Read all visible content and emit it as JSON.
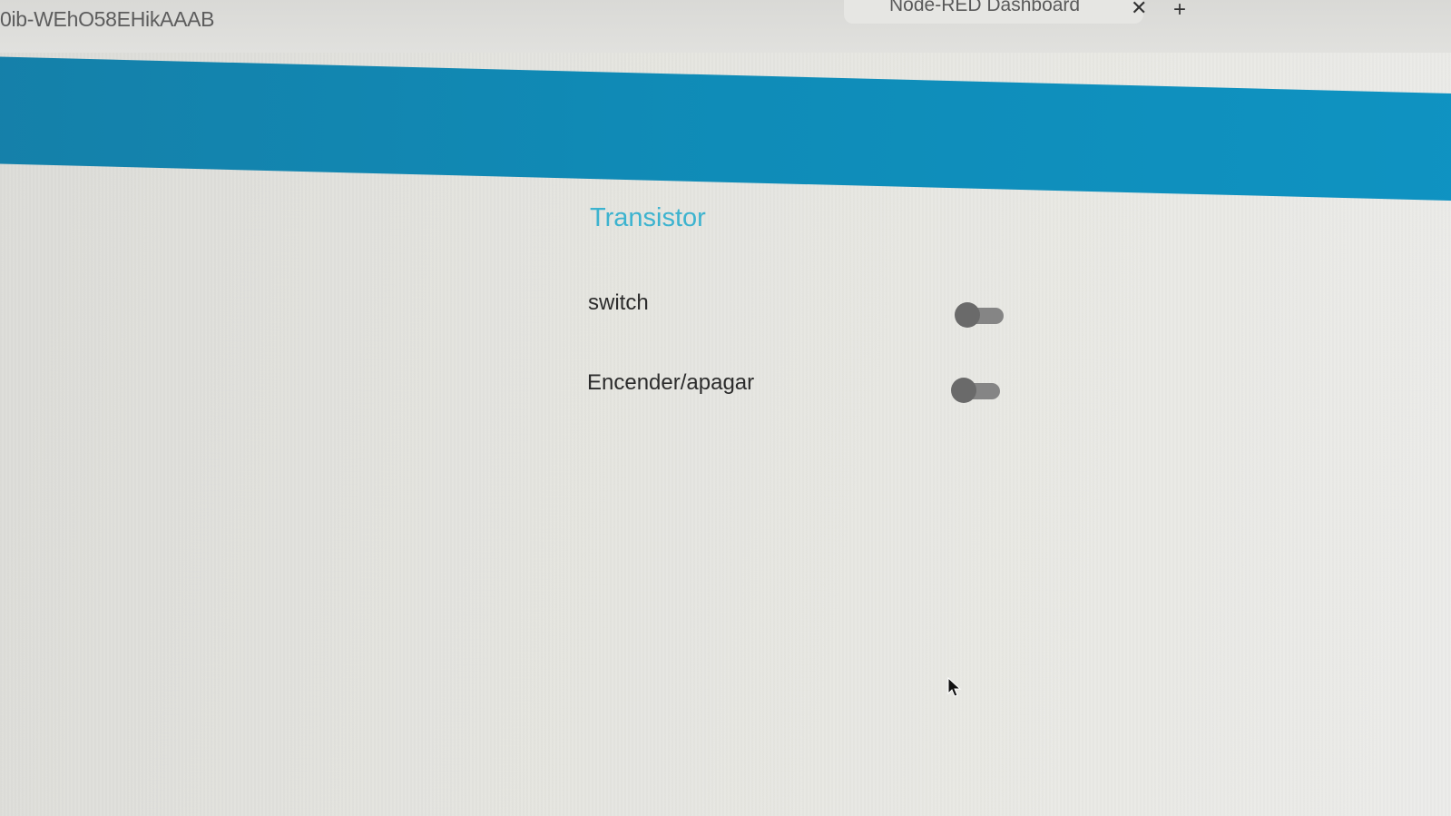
{
  "browser": {
    "url_fragment": "0ib-WEhO58EHikAAAB",
    "tab_title": "Node-RED Dashboard",
    "tab_close_icon": "close-icon",
    "new_tab_icon": "plus-icon"
  },
  "dashboard": {
    "header_color": "#1489b4",
    "group_title": "Transistor",
    "group_title_color": "#3cb3cf",
    "controls": [
      {
        "label": "switch",
        "state": "off"
      },
      {
        "label": "Encender/apagar",
        "state": "off"
      }
    ]
  },
  "pointer": {
    "icon": "mouse-cursor-icon"
  }
}
